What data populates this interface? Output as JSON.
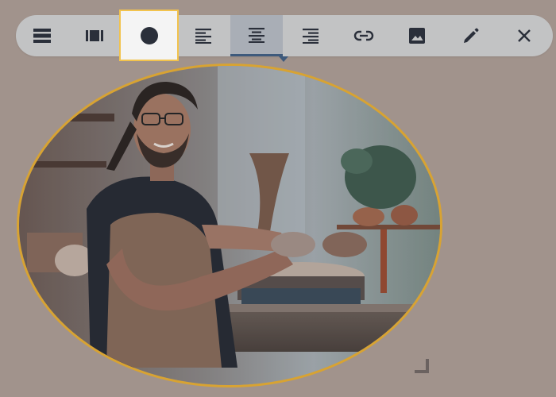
{
  "toolbar": {
    "buttons": [
      {
        "icon": "inline-block-icon",
        "state": "normal"
      },
      {
        "icon": "block-image-icon",
        "state": "normal"
      },
      {
        "icon": "circle-shape-icon",
        "state": "selected"
      },
      {
        "icon": "align-left-icon",
        "state": "normal"
      },
      {
        "icon": "align-center-icon",
        "state": "active"
      },
      {
        "icon": "align-right-icon",
        "state": "normal"
      },
      {
        "icon": "link-icon",
        "state": "normal"
      },
      {
        "icon": "image-icon",
        "state": "normal"
      },
      {
        "icon": "pencil-edit-icon",
        "state": "normal"
      },
      {
        "icon": "close-icon",
        "state": "normal"
      }
    ]
  },
  "image": {
    "shape": "ellipse",
    "subject": "potter-at-wheel-photo"
  },
  "colors": {
    "background": "#a1938c",
    "toolbar": "#c2c3c4",
    "icon": "#2a2f3a",
    "selected_outline": "#f2c34d",
    "active_underline": "#3e5a7c",
    "image_border": "#d8a332"
  }
}
